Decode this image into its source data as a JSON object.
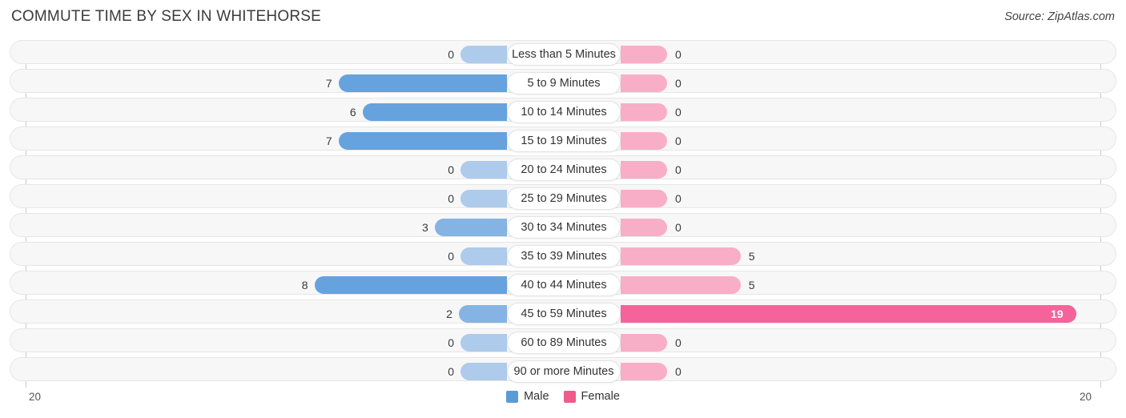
{
  "header": {
    "title": "COMMUTE TIME BY SEX IN WHITEHORSE",
    "source": "Source: ZipAtlas.com"
  },
  "legend": {
    "male_label": "Male",
    "female_label": "Female",
    "male_color": "#5B9BD5",
    "female_color": "#EE5C8C"
  },
  "axis": {
    "left_label": "20",
    "right_label": "20",
    "max": 20
  },
  "colors": {
    "male_strong": "#66A2DD",
    "male_mid": "#85B4E4",
    "male_light": "#AECBEC",
    "female_strong": "#F4649A",
    "female_light": "#F9AEC8",
    "track": "#F7F7F7",
    "track_border": "#E6E6E6"
  },
  "chart_data": {
    "type": "bar",
    "orientation": "horizontal-diverging",
    "title": "COMMUTE TIME BY SEX IN WHITEHORSE",
    "xlabel": "",
    "ylabel": "",
    "xlim": [
      20,
      20
    ],
    "grid": false,
    "legend_position": "bottom-center",
    "categories": [
      "Less than 5 Minutes",
      "5 to 9 Minutes",
      "10 to 14 Minutes",
      "15 to 19 Minutes",
      "20 to 24 Minutes",
      "25 to 29 Minutes",
      "30 to 34 Minutes",
      "35 to 39 Minutes",
      "40 to 44 Minutes",
      "45 to 59 Minutes",
      "60 to 89 Minutes",
      "90 or more Minutes"
    ],
    "series": [
      {
        "name": "Male",
        "values": [
          0,
          7,
          6,
          7,
          0,
          0,
          3,
          0,
          8,
          2,
          0,
          0
        ]
      },
      {
        "name": "Female",
        "values": [
          0,
          0,
          0,
          0,
          0,
          0,
          0,
          5,
          5,
          19,
          0,
          0
        ]
      }
    ]
  },
  "rows": [
    {
      "label": "Less than 5 Minutes",
      "male": "0",
      "female": "0"
    },
    {
      "label": "5 to 9 Minutes",
      "male": "7",
      "female": "0"
    },
    {
      "label": "10 to 14 Minutes",
      "male": "6",
      "female": "0"
    },
    {
      "label": "15 to 19 Minutes",
      "male": "7",
      "female": "0"
    },
    {
      "label": "20 to 24 Minutes",
      "male": "0",
      "female": "0"
    },
    {
      "label": "25 to 29 Minutes",
      "male": "0",
      "female": "0"
    },
    {
      "label": "30 to 34 Minutes",
      "male": "3",
      "female": "0"
    },
    {
      "label": "35 to 39 Minutes",
      "male": "0",
      "female": "5"
    },
    {
      "label": "40 to 44 Minutes",
      "male": "8",
      "female": "5"
    },
    {
      "label": "45 to 59 Minutes",
      "male": "2",
      "female": "19"
    },
    {
      "label": "60 to 89 Minutes",
      "male": "0",
      "female": "0"
    },
    {
      "label": "90 or more Minutes",
      "male": "0",
      "female": "0"
    }
  ]
}
